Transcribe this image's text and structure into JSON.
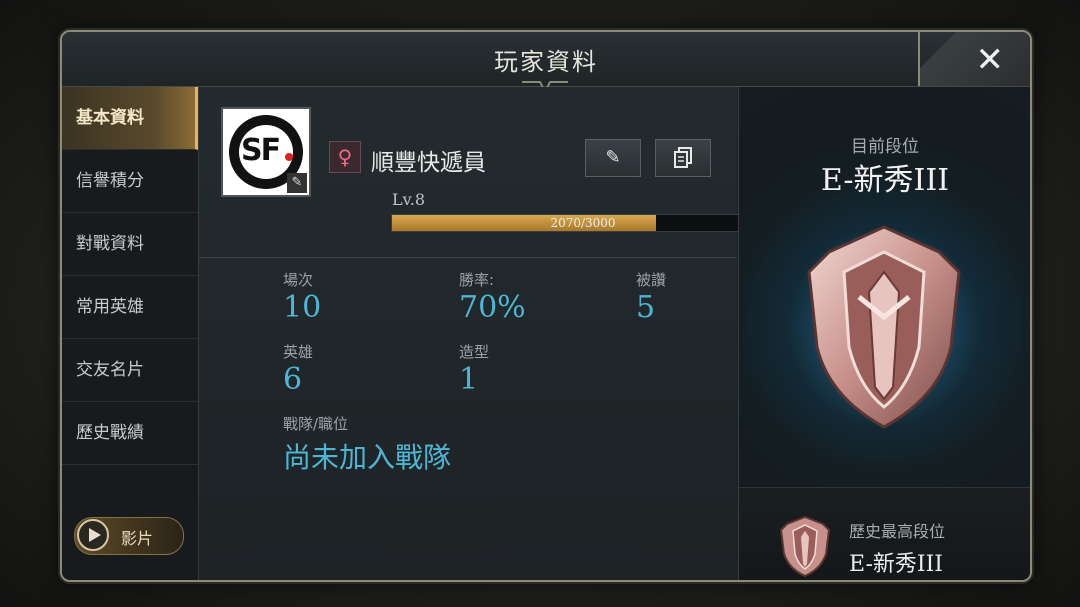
{
  "header": {
    "title": "玩家資料",
    "close_label": "✕"
  },
  "sidebar": {
    "items": [
      {
        "label": "基本資料",
        "active": true
      },
      {
        "label": "信譽積分",
        "active": false
      },
      {
        "label": "對戰資料",
        "active": false
      },
      {
        "label": "常用英雄",
        "active": false
      },
      {
        "label": "交友名片",
        "active": false
      },
      {
        "label": "歷史戰績",
        "active": false
      }
    ],
    "video_label": "影片"
  },
  "profile": {
    "avatar_text": "SF",
    "gender_symbol": "♀",
    "name": "順豐快遞員",
    "level": "Lv.8",
    "xp_text": "2070/3000",
    "xp_current": 2070,
    "xp_max": 3000
  },
  "stats": {
    "matches_label": "場次",
    "matches_value": "10",
    "winrate_label": "勝率:",
    "winrate_value": "70%",
    "likes_label": "被讚",
    "likes_value": "5",
    "heroes_label": "英雄",
    "heroes_value": "6",
    "skins_label": "造型",
    "skins_value": "1",
    "team_label": "戰隊/職位",
    "team_value": "尚未加入戰隊"
  },
  "rank": {
    "current_label": "目前段位",
    "current_name": "E-新秀III",
    "history_label": "歷史最高段位",
    "history_name": "E-新秀III"
  },
  "colors": {
    "accent_gold": "#e2b860",
    "stat_cyan": "#4db6d4",
    "xp_fill": "#c8963e",
    "female_pink": "#f06a86"
  }
}
